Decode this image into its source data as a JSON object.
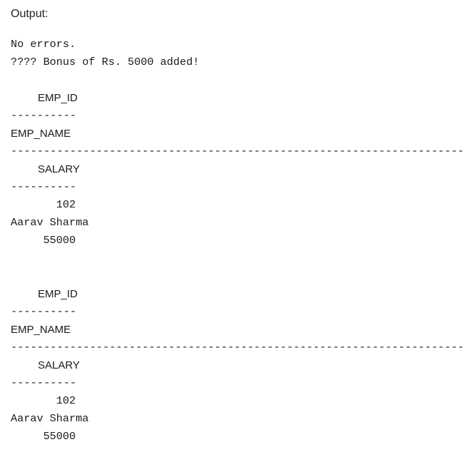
{
  "header": {
    "label": "Output:"
  },
  "messages": {
    "status": "No errors.",
    "bonus": "???? Bonus of Rs. 5000 added!"
  },
  "result_blocks": [
    {
      "emp_id_header": "EMP_ID",
      "emp_id_underline": "----------",
      "emp_name_header": "EMP_NAME",
      "emp_name_underline": "--------------------------------------------------------------------------------",
      "salary_header": "SALARY",
      "salary_underline": "----------",
      "emp_id_value": "       102",
      "emp_name_value": "Aarav Sharma",
      "salary_value": "     55000"
    },
    {
      "emp_id_header": "EMP_ID",
      "emp_id_underline": "----------",
      "emp_name_header": "EMP_NAME",
      "emp_name_underline": "--------------------------------------------------------------------------------",
      "salary_header": "SALARY",
      "salary_underline": "----------",
      "emp_id_value": "       102",
      "emp_name_value": "Aarav Sharma",
      "salary_value": "     55000"
    }
  ]
}
